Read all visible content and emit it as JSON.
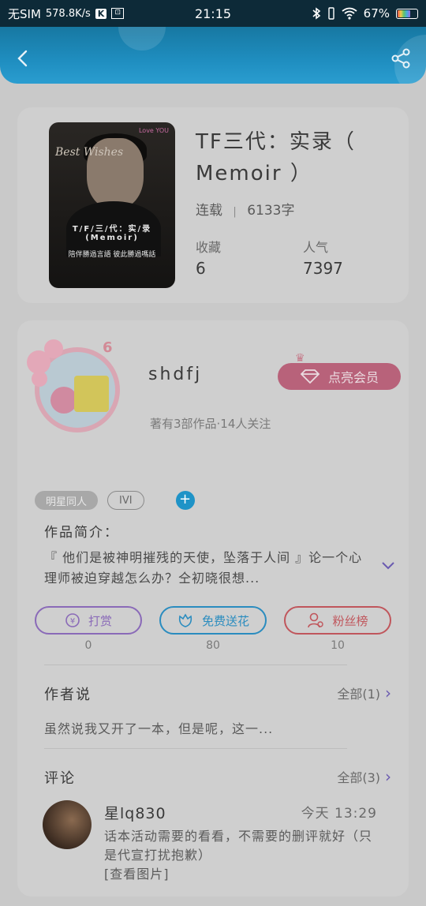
{
  "status_bar": {
    "carrier": "无SIM",
    "speed": "578.8K/s",
    "k_badge": "K",
    "box_icon": "⊡",
    "time": "21:15",
    "battery_pct": "67%",
    "icons": [
      "bluetooth-icon",
      "vibrate-icon",
      "wifi-icon",
      "battery-icon"
    ]
  },
  "header": {
    "back_icon": "chevron-left-icon",
    "share_icon": "share-icon",
    "color": "#1f8ec0"
  },
  "book": {
    "title": "TF三代：实录（ Memoir ）",
    "status": "连载",
    "sep": "|",
    "word_count": "6133字",
    "favorites_label": "收藏",
    "favorites_value": "6",
    "popularity_label": "人气",
    "popularity_value": "7397",
    "cover_script": "Best Wishes",
    "cover_tag": "Love YOU",
    "cover_title": "T/F/三/代：实/录(Memoir)",
    "cover_sub": "陪伴勝過言語 彼此勝過嗎話"
  },
  "author": {
    "level": "6",
    "name": "shdfj",
    "vip_label": "点亮会员",
    "works": "著有3部作品·14人关注"
  },
  "tags": [
    "明星同人",
    "IVI"
  ],
  "tag_add": "+",
  "intro": {
    "title": "作品简介：",
    "text": "『 他们是被神明摧残的天使，坠落于人间 』论一个心理师被迫穿越怎么办？仝初晓很想..."
  },
  "actions": [
    {
      "label": "打赏",
      "count": "0",
      "color": "#8a6ab8"
    },
    {
      "label": "免费送花",
      "count": "80",
      "color": "#2a8cbf"
    },
    {
      "label": "粉丝榜",
      "count": "10",
      "color": "#c0565c"
    }
  ],
  "author_says": {
    "title": "作者说",
    "all": "全部(1)",
    "text": "虽然说我又开了一本，但是呢，这一..."
  },
  "comments": {
    "title": "评论",
    "all": "全部(3)",
    "item": {
      "name": "星lq830",
      "time": "今天 13:29",
      "text": "话本活动需要的看看，不需要的删评就好（只是代宣打扰抱歉）",
      "image_link": "[查看图片]"
    }
  }
}
